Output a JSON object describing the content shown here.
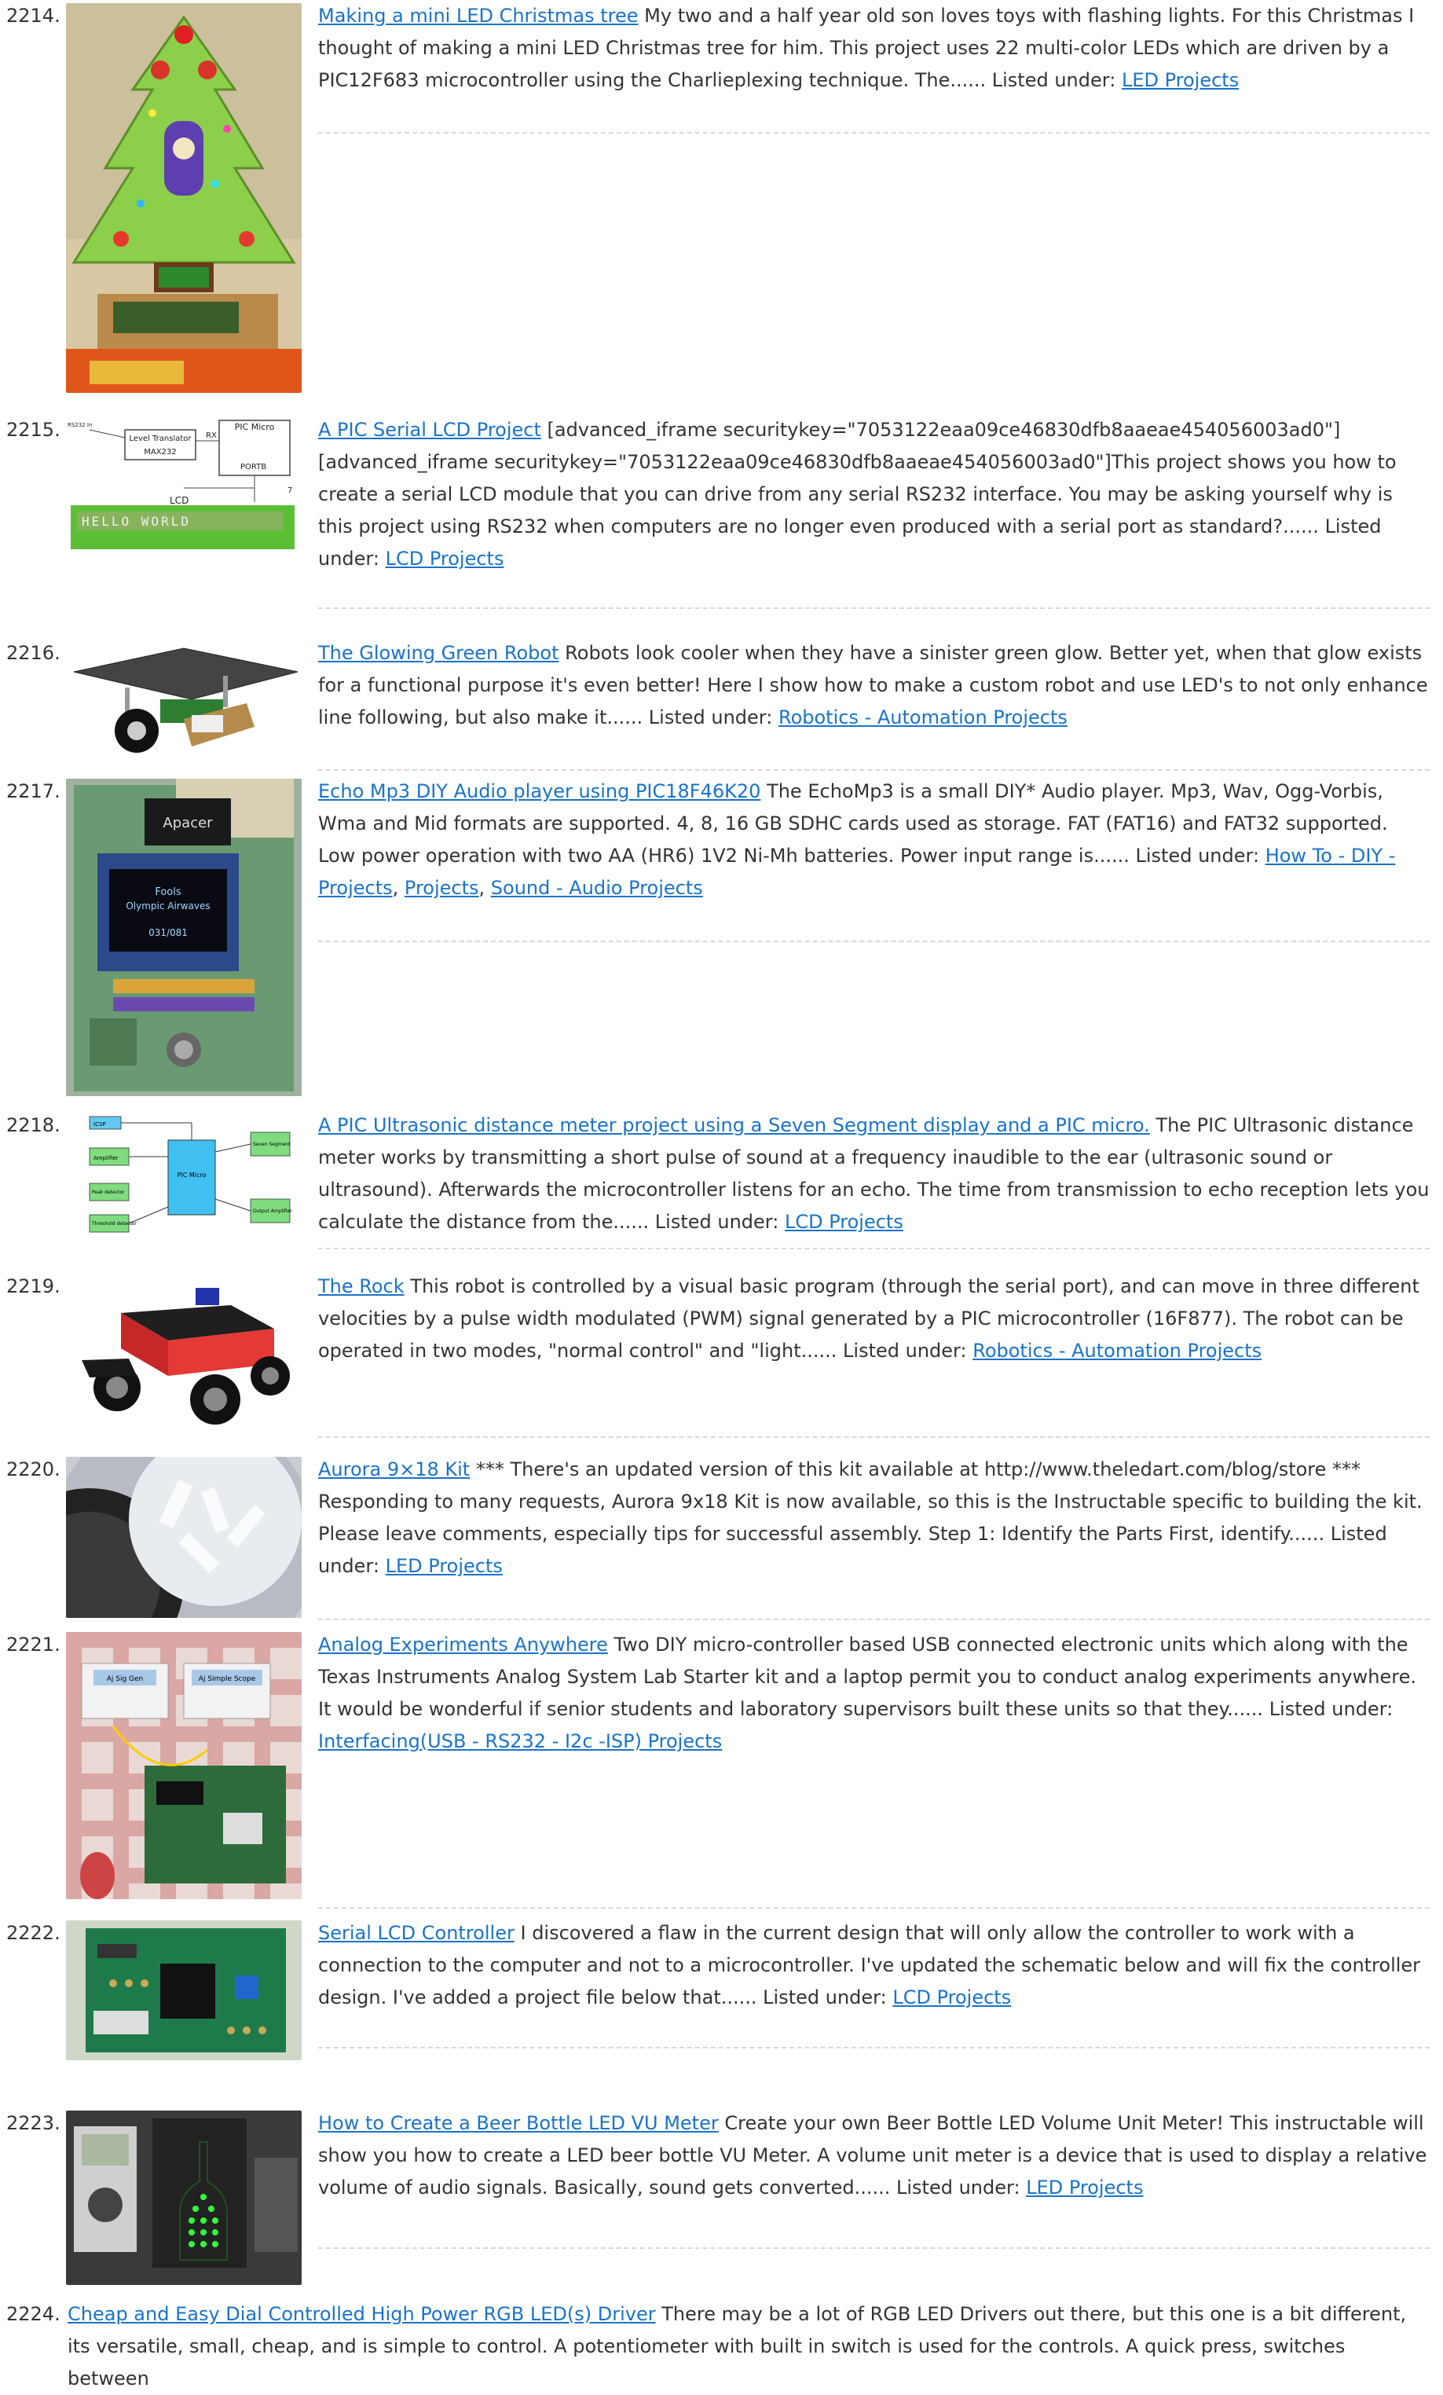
{
  "items": [
    {
      "num": "2214.",
      "title": "Making a mini LED Christmas tree",
      "body": "My two and a half year old son loves toys with flashing lights. For this Christmas I thought of making a mini LED Christmas tree for him. This project uses 22 multi-color LEDs which are driven by a PIC12F683 microcontroller using the Charlieplexing technique. The......",
      "listed": "Listed under:",
      "cats": [
        "LED Projects"
      ],
      "thumb": "christmas-tree-photo"
    },
    {
      "num": "2215.",
      "title": "A PIC Serial LCD Project",
      "body": "[advanced_iframe securitykey=\"7053122eaa09ce46830dfb8aaeae454056003ad0\"] [advanced_iframe securitykey=\"7053122eaa09ce46830dfb8aaeae454056003ad0\"]This project shows you how to create a serial LCD module that you can drive from any serial RS232 interface. You may be asking yourself why is this project using RS232 when computers are no longer even produced with a serial port as standard?......",
      "listed": "Listed under:",
      "cats": [
        "LCD Projects"
      ],
      "thumb": "serial-lcd-diagram",
      "thumb_text": {
        "t1": "PIC Micro",
        "t2": "Level Translator",
        "t3": "MAX232",
        "t4": "RS232 In",
        "t5": "RX",
        "t6": "PORTB",
        "t7": "LCD",
        "t8": "7",
        "lcd": "HELLO WORLD"
      }
    },
    {
      "num": "2216.",
      "title": "The Glowing Green Robot",
      "body": "Robots look cooler when they have a sinister green glow. Better yet, when that glow exists for a functional purpose it's even better! Here I show how to make a custom robot and use LED's to not only enhance line following, but also make it......",
      "listed": "Listed under:",
      "cats": [
        "Robotics - Automation Projects"
      ],
      "thumb": "robot-render"
    },
    {
      "num": "2217.",
      "title": "Echo Mp3 DIY Audio player using PIC18F46K20",
      "body": "The EchoMp3 is a small DIY* Audio player. Mp3, Wav, Ogg-Vorbis, Wma and Mid formats are supported. 4, 8, 16 GB SDHC cards used as storage. FAT (FAT16) and FAT32 supported. Low power operation with two AA (HR6) 1V2 Ni-Mh batteries. Power input range is......",
      "listed": "Listed under:",
      "cats": [
        "How To - DIY - Projects",
        "Projects",
        "Sound - Audio Projects"
      ],
      "thumb": "mp3-board-photo",
      "thumb_text": {
        "brand": "Apacer",
        "l1": "Fools",
        "l2": "Olympic Airwaves",
        "l3": "031/081"
      }
    },
    {
      "num": "2218.",
      "title": "A PIC Ultrasonic distance meter project using a Seven Segment display and a PIC micro.",
      "body": "The PIC Ultrasonic distance meter works by transmitting a short pulse of sound at a frequency inaudible to the ear (ultrasonic sound or ultrasound). Afterwards the microcontroller listens for an echo. The time from transmission to echo reception lets you calculate the distance from the......",
      "listed": "Listed under:",
      "cats": [
        "LCD Projects"
      ],
      "thumb": "ultrasonic-block-diagram",
      "thumb_text": {
        "b1": "ICSP",
        "b2": "Amplifier",
        "b3": "Peak detector",
        "b4": "Threshold detector",
        "b5": "PIC Micro",
        "b6": "Seven Segment",
        "b7": "Output Amplifier"
      }
    },
    {
      "num": "2219.",
      "title": "The Rock",
      "body": "This robot is controlled by a visual basic program (through the serial port), and can move in three different velocities by a pulse width modulated (PWM) signal generated by a PIC microcontroller (16F877). The robot can be operated in two modes, \"normal control\" and \"light......",
      "listed": "Listed under:",
      "cats": [
        "Robotics - Automation Projects"
      ],
      "thumb": "rover-render"
    },
    {
      "num": "2220.",
      "title": "Aurora 9×18 Kit",
      "body": "*** There's an updated version of this kit available at http://www.theledart.com/blog/store *** Responding to many requests, Aurora 9x18 Kit is now available, so this is the Instructable specific to building the kit. Please leave comments, especially tips for successful assembly. Step 1: Identify the Parts First, identify......",
      "listed": "Listed under:",
      "cats": [
        "LED Projects"
      ],
      "thumb": "led-kit-photo"
    },
    {
      "num": "2221.",
      "title": "Analog Experiments Anywhere",
      "body": "Two DIY micro-controller based USB connected electronic units which along with the Texas Instruments Analog System Lab Starter kit and a laptop permit you to conduct analog experiments anywhere. It would be wonderful  if senior students and laboratory supervisors built these units so that they......",
      "listed": "Listed under:",
      "cats": [
        "Interfacing(USB - RS232 - I2c -ISP) Projects"
      ],
      "thumb": "analog-units-photo",
      "thumb_text": {
        "u1": "Aj Sig Gen",
        "u2": "Aj Simple Scope"
      }
    },
    {
      "num": "2222.",
      "title": "Serial LCD Controller",
      "body": "I discovered a flaw in the current design that will only allow the controller to work with a connection to the computer and not to a microcontroller.  I've updated the schematic below and will fix the controller design.  I've added a project file below that......",
      "listed": "Listed under:",
      "cats": [
        "LCD Projects"
      ],
      "thumb": "lcd-controller-pcb"
    },
    {
      "num": "2223.",
      "title": "How to Create a Beer Bottle LED VU Meter",
      "body": "Create your own Beer Bottle LED Volume Unit Meter! This instructable will show you how to create a LED beer bottle VU Meter. A volume unit meter is a device that is used to display a relative volume of audio signals. Basically, sound gets converted......",
      "listed": "Listed under:",
      "cats": [
        "LED Projects"
      ],
      "thumb": "vu-meter-photo"
    },
    {
      "num": "2224.",
      "title": "Cheap and Easy Dial Controlled High Power RGB LED(s) Driver",
      "body": "There may be a lot of RGB LED Drivers out there, but this one is a bit different, its versatile, small, cheap, and is simple to control. A potentiometer with built in switch is used for the controls. A quick press, switches between",
      "listed": "",
      "cats": [],
      "thumb": ""
    }
  ],
  "colors": {
    "link": "#1a73c8",
    "text": "#333333",
    "separator": "#d9d9d9"
  }
}
